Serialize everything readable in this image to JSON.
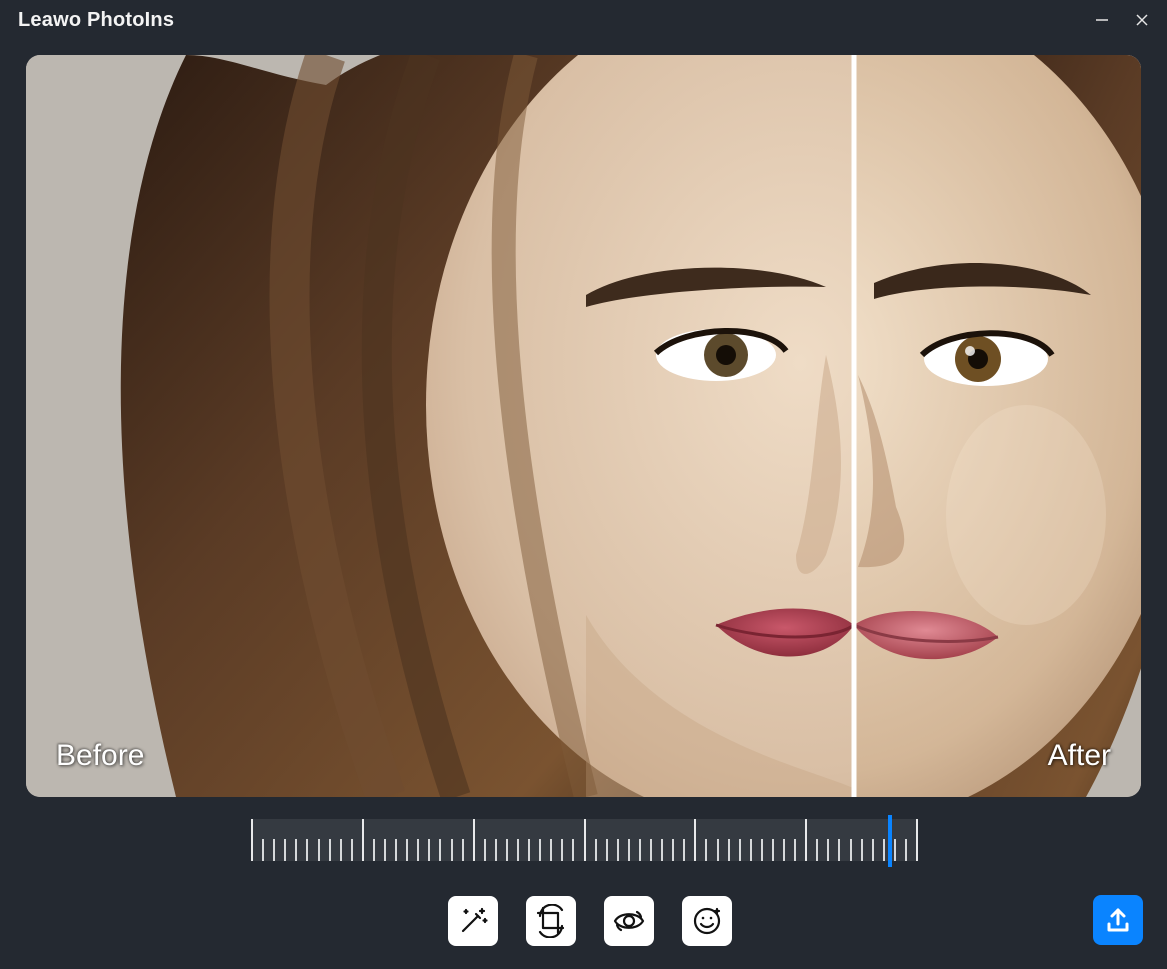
{
  "app": {
    "title": "Leawo PhotoIns"
  },
  "window_controls": {
    "minimize": "minimize-icon",
    "close": "close-icon"
  },
  "preview": {
    "before_label": "Before",
    "after_label": "After",
    "divider_position_percent": 74.3
  },
  "ruler": {
    "major_ticks": 6,
    "minor_per_segment": 9,
    "thumb_position_percent": 96.1
  },
  "tools": [
    {
      "name": "auto-enhance",
      "icon": "magic-wand-icon"
    },
    {
      "name": "crop-rotate",
      "icon": "crop-icon"
    },
    {
      "name": "eye-enhance",
      "icon": "eye-icon"
    },
    {
      "name": "face-enhance",
      "icon": "smiley-icon"
    }
  ],
  "export": {
    "icon": "export-icon"
  },
  "colors": {
    "accent": "#0a84ff",
    "bg": "#242931",
    "panel": "#353a41",
    "icon_tile": "#ffffff"
  }
}
